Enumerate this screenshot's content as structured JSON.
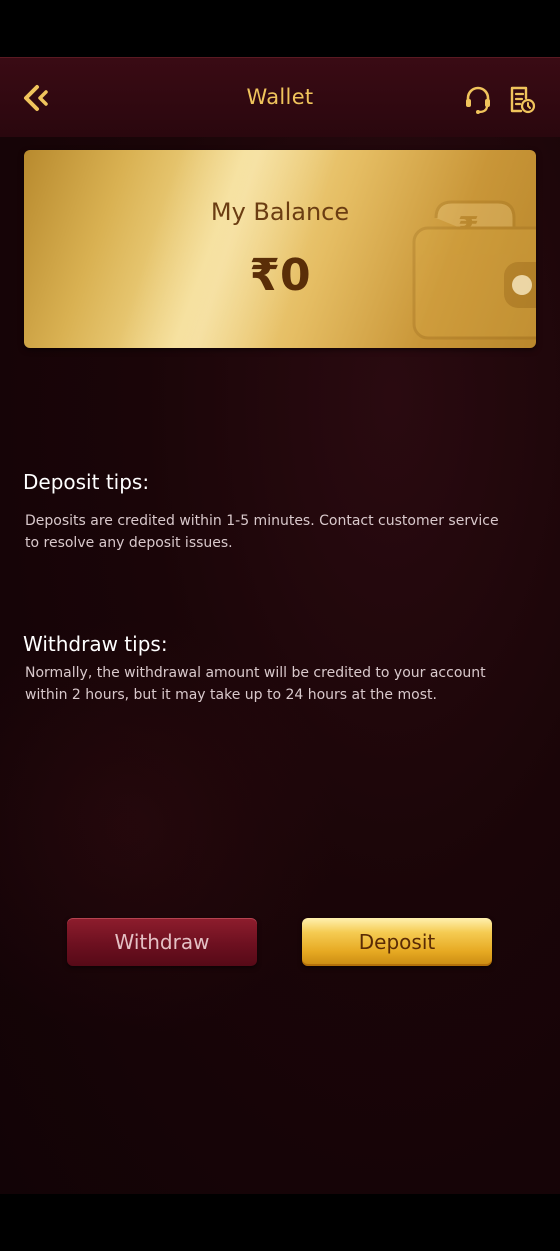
{
  "header": {
    "title": "Wallet",
    "back_icon": "back-chevron-icon",
    "support_icon": "headset-icon",
    "history_icon": "history-document-icon"
  },
  "balance": {
    "label": "My Balance",
    "value": "₹0"
  },
  "deposit_tips": {
    "title": "Deposit tips:",
    "text": "Deposits are credited within 1-5 minutes. Contact customer service to resolve any deposit issues."
  },
  "withdraw_tips": {
    "title": "Withdraw tips:",
    "text": "Normally, the withdrawal amount will be credited to your account within 2 hours, but it may take up to 24 hours at the most."
  },
  "actions": {
    "withdraw_label": "Withdraw",
    "deposit_label": "Deposit"
  },
  "colors": {
    "accent_gold": "#f0c45c",
    "background": "#1a0508",
    "withdraw_button": "#6d1020",
    "deposit_button": "#f5cb52"
  }
}
